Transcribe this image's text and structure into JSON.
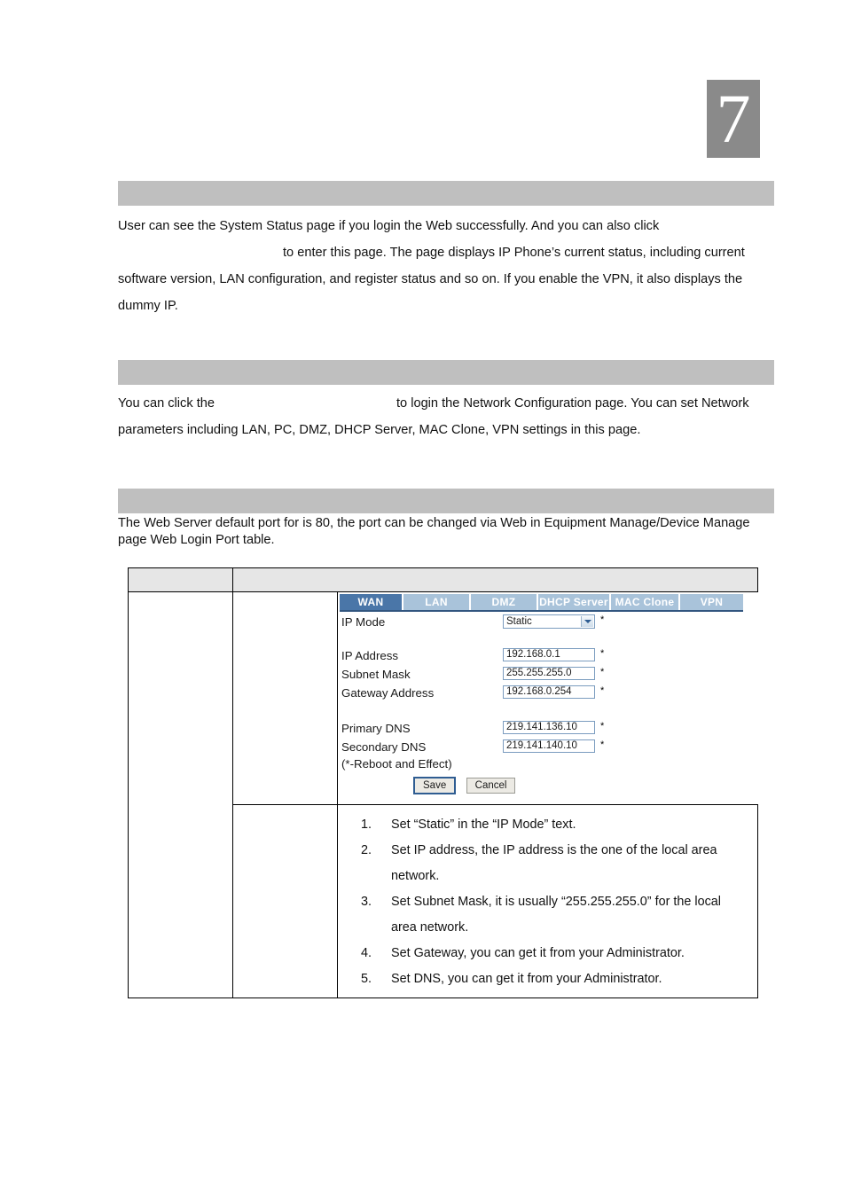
{
  "chapter": {
    "number": "7"
  },
  "sections": [
    {
      "id": "system-status",
      "bar_label": ""
    },
    {
      "id": "network-configuration",
      "bar_label": ""
    },
    {
      "id": "web-server-port",
      "bar_label": ""
    }
  ],
  "paragraphs": {
    "system_status_part1": "User can see the System Status page if you login the Web successfully. And you can also click",
    "system_status_part2": "to enter this page. The page displays IP Phone’s current status, including current software version, LAN configuration, and register status and so on. If you enable the VPN, it also displays the dummy IP.",
    "network_part1": "You can click the",
    "network_part2": "to login the Network Configuration page. You can set Network parameters including LAN, PC, DMZ, DHCP Server, MAC Clone, VPN settings in this page.",
    "web_server": "The Web Server default port for is 80, the port can be changed via Web in Equipment Manage/Device Manage page Web Login Port table."
  },
  "table": {
    "header": {
      "col_a": "",
      "col_b": ""
    },
    "cells": {
      "row1_col_a": "",
      "row1_col_b": "",
      "row2_col_a": "",
      "row2_col_b": ""
    }
  },
  "webui": {
    "tabs": [
      {
        "label": "WAN",
        "active": true
      },
      {
        "label": "LAN",
        "active": false
      },
      {
        "label": "DMZ",
        "active": false
      },
      {
        "label": "DHCP Server",
        "active": false
      },
      {
        "label": "MAC Clone",
        "active": false
      },
      {
        "label": "VPN",
        "active": false
      }
    ],
    "fields": [
      {
        "label": "IP Mode",
        "value": "Static",
        "type": "select",
        "required_mark": "*"
      },
      {
        "label": "IP Address",
        "value": "192.168.0.1",
        "type": "text",
        "required_mark": "*"
      },
      {
        "label": "Subnet Mask",
        "value": "255.255.255.0",
        "type": "text",
        "required_mark": "*"
      },
      {
        "label": "Gateway Address",
        "value": "192.168.0.254",
        "type": "text",
        "required_mark": "*"
      },
      {
        "label": "Primary DNS",
        "value": "219.141.136.10",
        "type": "text",
        "required_mark": "*"
      },
      {
        "label": "Secondary DNS",
        "value": "219.141.140.10",
        "type": "text",
        "required_mark": "*"
      }
    ],
    "note": "(*-Reboot and Effect)",
    "buttons": {
      "save": "Save",
      "cancel": "Cancel"
    }
  },
  "steps": [
    {
      "num": "1.",
      "text": "Set “Static” in the “IP Mode” text."
    },
    {
      "num": "2.",
      "text": "Set IP address, the IP address is the one of the local area network."
    },
    {
      "num": "3.",
      "text": "Set Subnet Mask, it is usually “255.255.255.0” for the local area network."
    },
    {
      "num": "4.",
      "text": "Set Gateway, you can get it from your Administrator."
    },
    {
      "num": "5.",
      "text": "Set DNS, you can get it from your Administrator."
    }
  ],
  "colors": {
    "chapter_box": "#8a8a8a",
    "section_bar": "#bfbfbf",
    "table_header": "#e6e6e6",
    "tab_active": "#4a76a8",
    "tab_inactive": "#a9c3da",
    "tab_underline": "#32567f",
    "field_border": "#7b9cbf"
  }
}
